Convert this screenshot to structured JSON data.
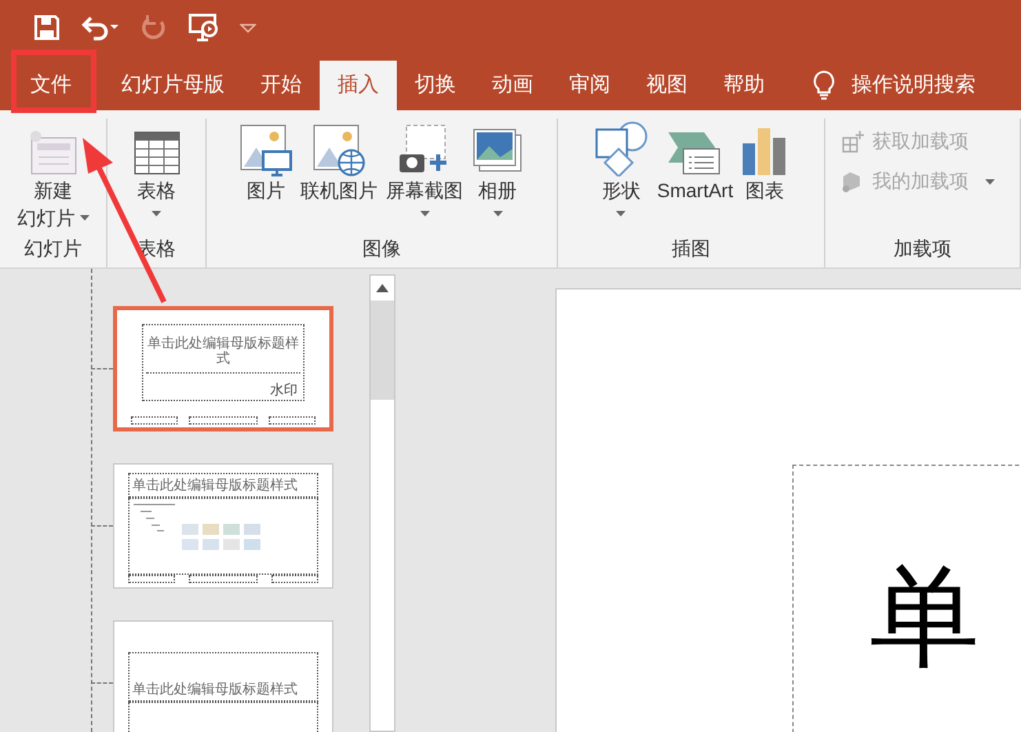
{
  "tabs": [
    {
      "label": "文件",
      "selected": false
    },
    {
      "label": "幻灯片母版",
      "selected": false
    },
    {
      "label": "开始",
      "selected": false
    },
    {
      "label": "插入",
      "selected": true
    },
    {
      "label": "切换",
      "selected": false
    },
    {
      "label": "动画",
      "selected": false
    },
    {
      "label": "审阅",
      "selected": false
    },
    {
      "label": "视图",
      "selected": false
    },
    {
      "label": "帮助",
      "selected": false
    }
  ],
  "search": {
    "label": "操作说明搜索"
  },
  "ribbon_groups": [
    {
      "label": "幻灯片",
      "items": [
        {
          "kind": "large",
          "lines": [
            "新建",
            "幻灯片"
          ],
          "dropdown": true,
          "disabled": false
        }
      ]
    },
    {
      "label": "表格",
      "items": [
        {
          "kind": "large",
          "label": "表格",
          "dropdown": true,
          "disabled": false
        }
      ]
    },
    {
      "label": "图像",
      "items": [
        {
          "kind": "large",
          "label": "图片",
          "dropdown": false,
          "disabled": false
        },
        {
          "kind": "large",
          "label": "联机图片",
          "dropdown": false,
          "disabled": false
        },
        {
          "kind": "large",
          "label": "屏幕截图",
          "dropdown": true,
          "disabled": false
        },
        {
          "kind": "large",
          "label": "相册",
          "dropdown": true,
          "disabled": false
        }
      ]
    },
    {
      "label": "插图",
      "items": [
        {
          "kind": "large",
          "label": "形状",
          "dropdown": true,
          "disabled": false
        },
        {
          "kind": "large",
          "label": "SmartArt",
          "dropdown": false,
          "disabled": false
        },
        {
          "kind": "large",
          "label": "图表",
          "dropdown": false,
          "disabled": false
        }
      ]
    },
    {
      "label": "加载项",
      "items": [
        {
          "kind": "small",
          "label": "获取加载项",
          "dropdown": false,
          "disabled": true
        },
        {
          "kind": "small",
          "label": "我的加载项",
          "dropdown": true,
          "disabled": true
        }
      ]
    }
  ],
  "thumbnails": [
    {
      "kind": "title",
      "selected": true,
      "title": "单击此处编辑母版标题样式",
      "note": "水印"
    },
    {
      "kind": "content",
      "selected": false,
      "title": "单击此处编辑母版标题样式"
    },
    {
      "kind": "title_only",
      "selected": false,
      "title": "单击此处编辑母版标题样式"
    }
  ],
  "slide": {
    "title": "单"
  }
}
